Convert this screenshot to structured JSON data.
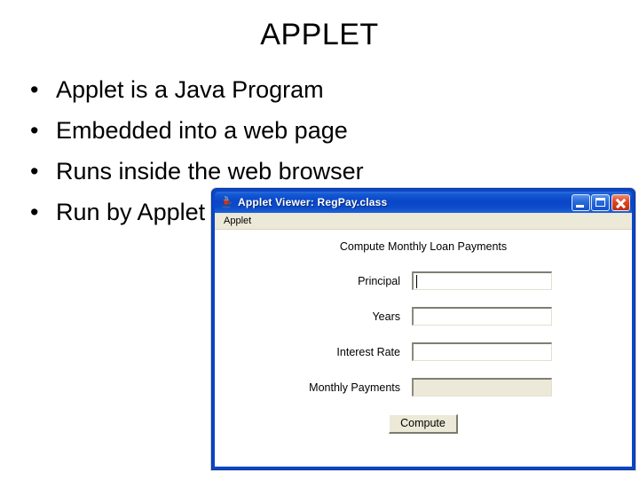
{
  "slide": {
    "title": "APPLET",
    "bullets": [
      {
        "marker": "•",
        "text": "Applet is a Java Program"
      },
      {
        "marker": "•",
        "text": "Embedded into a web page"
      },
      {
        "marker": "•",
        "text": "Runs inside the web browser"
      },
      {
        "marker": "•",
        "text": "Run by Applet"
      }
    ]
  },
  "applet_window": {
    "title": "Applet Viewer: RegPay.class",
    "icon": "java-cup-icon",
    "controls": {
      "minimize": "minimize-button",
      "maximize": "maximize-button",
      "close": "close-button"
    },
    "menubar": {
      "items": [
        "Applet"
      ]
    },
    "form": {
      "heading": "Compute Monthly Loan Payments",
      "fields": [
        {
          "label": "Principal",
          "value": "",
          "readonly": false,
          "focused": true
        },
        {
          "label": "Years",
          "value": "",
          "readonly": false,
          "focused": false
        },
        {
          "label": "Interest Rate",
          "value": "",
          "readonly": false,
          "focused": false
        },
        {
          "label": "Monthly Payments",
          "value": "",
          "readonly": true,
          "focused": false
        }
      ],
      "compute_label": "Compute"
    }
  },
  "colors": {
    "titlebar_blue": "#0a46c8",
    "window_chrome": "#ece9d8",
    "close_red": "#dd4b28",
    "canvas_white": "#ffffff",
    "text_black": "#000000"
  }
}
